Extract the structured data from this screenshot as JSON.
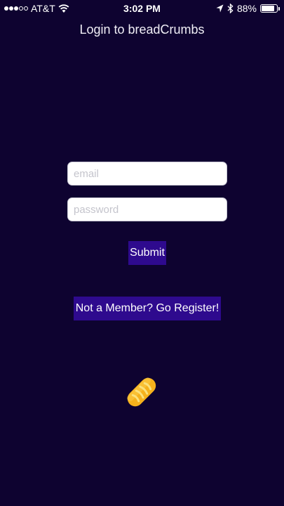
{
  "status_bar": {
    "carrier": "AT&T",
    "time": "3:02 PM",
    "battery_percent": "88%",
    "battery_level": 0.88,
    "signal_bars_filled": 3,
    "signal_bars_total": 5
  },
  "header": {
    "title": "Login to breadCrumbs"
  },
  "form": {
    "email_placeholder": "email",
    "password_placeholder": "password",
    "submit_label": "Submit"
  },
  "register_label": "Not a Member? Go Register!",
  "logo_icon": "bread-loaf-icon",
  "colors": {
    "background": "#0e0330",
    "button": "#2e0a8e",
    "bread": "#f6b21c"
  }
}
